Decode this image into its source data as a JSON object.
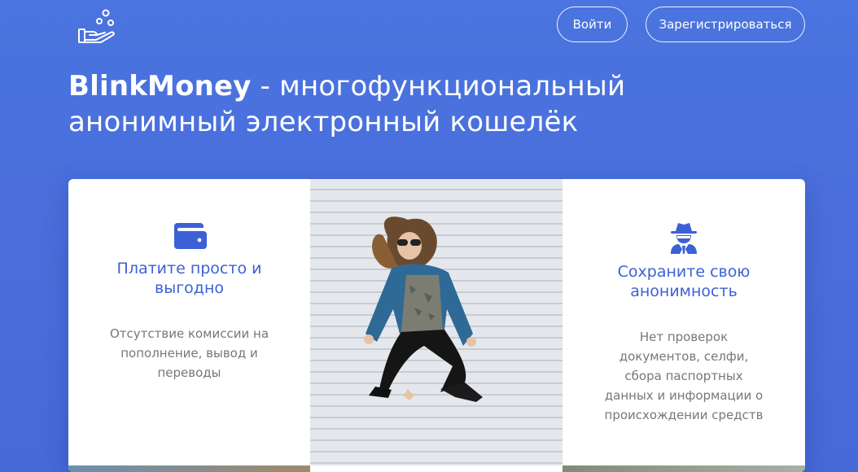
{
  "header": {
    "logo_icon": "hand-coins-icon",
    "login_label": "Войти",
    "register_label": "Зарегистрироваться"
  },
  "hero": {
    "brand": "BlinkMoney",
    "tagline": " - многофункциональный анонимный электронный кошелёк"
  },
  "features": [
    {
      "icon": "wallet-icon",
      "title": "Платите просто и выгодно",
      "text": "Отсутствие комиссии на пополнение, вывод и переводы"
    },
    {
      "icon": "spy-icon",
      "title": "Сохраните свою анонимность",
      "text": "Нет проверок документов, селфи, сбора паспортных данных и информации о происхождении средств"
    }
  ],
  "colors": {
    "background": "#4a70dc",
    "accent": "#3c61d6",
    "body_text": "#777777"
  }
}
